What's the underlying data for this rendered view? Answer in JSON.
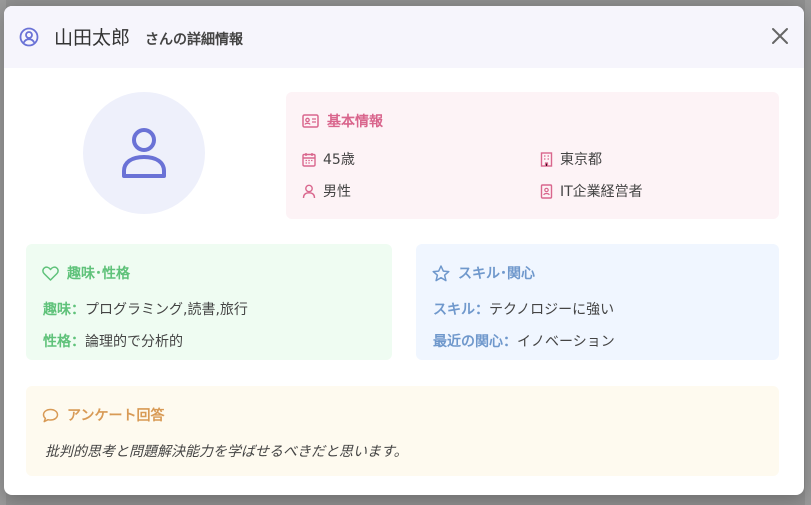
{
  "header": {
    "name": "山田太郎",
    "suffix": "さんの詳細情報"
  },
  "basic_info": {
    "title": "基本情報",
    "age": "45歳",
    "location": "東京都",
    "gender": "男性",
    "occupation": "IT企業経営者"
  },
  "hobby": {
    "title": "趣味･性格",
    "hobby_label": "趣味：",
    "hobby_value": "プログラミング,読書,旅行",
    "personality_label": "性格：",
    "personality_value": "論理的で分析的"
  },
  "skill": {
    "title": "スキル･関心",
    "skill_label": "スキル：",
    "skill_value": "テクノロジーに強い",
    "interest_label": "最近の関心：",
    "interest_value": "イノベーション"
  },
  "survey": {
    "title": "アンケート回答",
    "answer": "批判的思考と問題解決能力を学ばせるべきだと思います。"
  },
  "colors": {
    "accent": "#6a72d6",
    "pink": "#d9668d",
    "green": "#5fc27a",
    "blue": "#6f98cc",
    "orange": "#d89a55"
  },
  "icons": [
    "user-circle-icon",
    "close-icon",
    "user-icon",
    "id-card-icon",
    "calendar-icon",
    "building-icon",
    "person-icon",
    "badge-icon",
    "heart-icon",
    "star-icon",
    "chat-icon"
  ]
}
